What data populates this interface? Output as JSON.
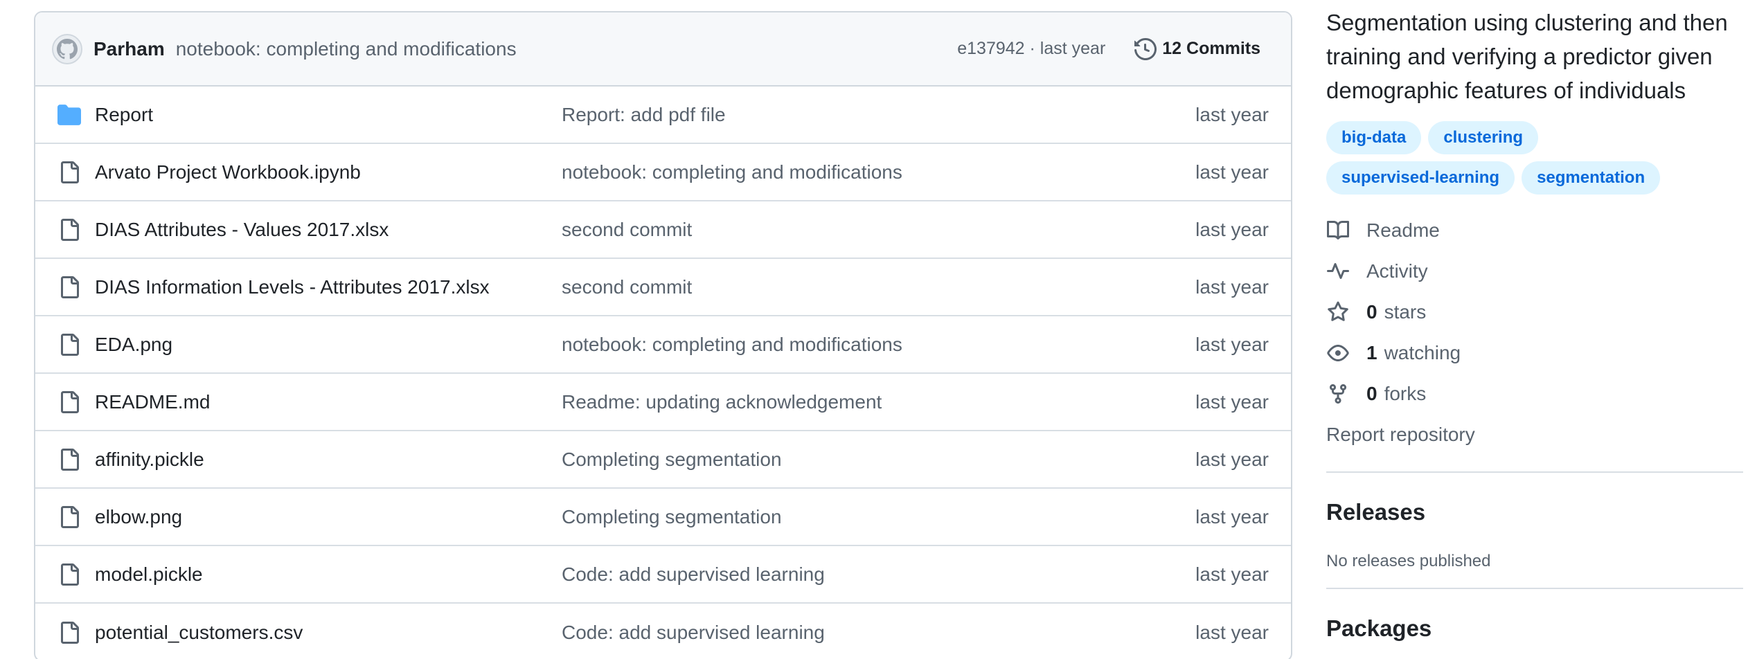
{
  "commit": {
    "author": "Parham",
    "message": "notebook: completing and modifications",
    "hash_time": "e137942 · last year",
    "commits_count": "12 Commits"
  },
  "files": [
    {
      "name": "Report",
      "type": "folder",
      "commit": "Report: add pdf file",
      "time": "last year"
    },
    {
      "name": "Arvato Project Workbook.ipynb",
      "type": "file",
      "commit": "notebook: completing and modifications",
      "time": "last year"
    },
    {
      "name": "DIAS Attributes - Values 2017.xlsx",
      "type": "file",
      "commit": "second commit",
      "time": "last year"
    },
    {
      "name": "DIAS Information Levels - Attributes 2017.xlsx",
      "type": "file",
      "commit": "second commit",
      "time": "last year"
    },
    {
      "name": "EDA.png",
      "type": "file",
      "commit": "notebook: completing and modifications",
      "time": "last year"
    },
    {
      "name": "README.md",
      "type": "file",
      "commit": "Readme: updating acknowledgement",
      "time": "last year"
    },
    {
      "name": "affinity.pickle",
      "type": "file",
      "commit": "Completing segmentation",
      "time": "last year"
    },
    {
      "name": "elbow.png",
      "type": "file",
      "commit": "Completing segmentation",
      "time": "last year"
    },
    {
      "name": "model.pickle",
      "type": "file",
      "commit": "Code: add supervised learning",
      "time": "last year"
    },
    {
      "name": "potential_customers.csv",
      "type": "file",
      "commit": "Code: add supervised learning",
      "time": "last year"
    }
  ],
  "sidebar": {
    "about": "Segmentation using clustering and then training and verifying a predictor given demographic features of individuals",
    "topics": [
      "big-data",
      "clustering",
      "supervised-learning",
      "segmentation"
    ],
    "readme": "Readme",
    "activity": "Activity",
    "stars_count": "0",
    "stars_label": "stars",
    "watching_count": "1",
    "watching_label": "watching",
    "forks_count": "0",
    "forks_label": "forks",
    "report": "Report repository",
    "releases_title": "Releases",
    "releases_note": "No releases published",
    "packages_title": "Packages"
  },
  "colors": {
    "folder": "#54aeff",
    "topic_bg": "#ddf4ff",
    "topic_fg": "#0969da",
    "muted": "#59636e",
    "border": "#d0d7de"
  }
}
